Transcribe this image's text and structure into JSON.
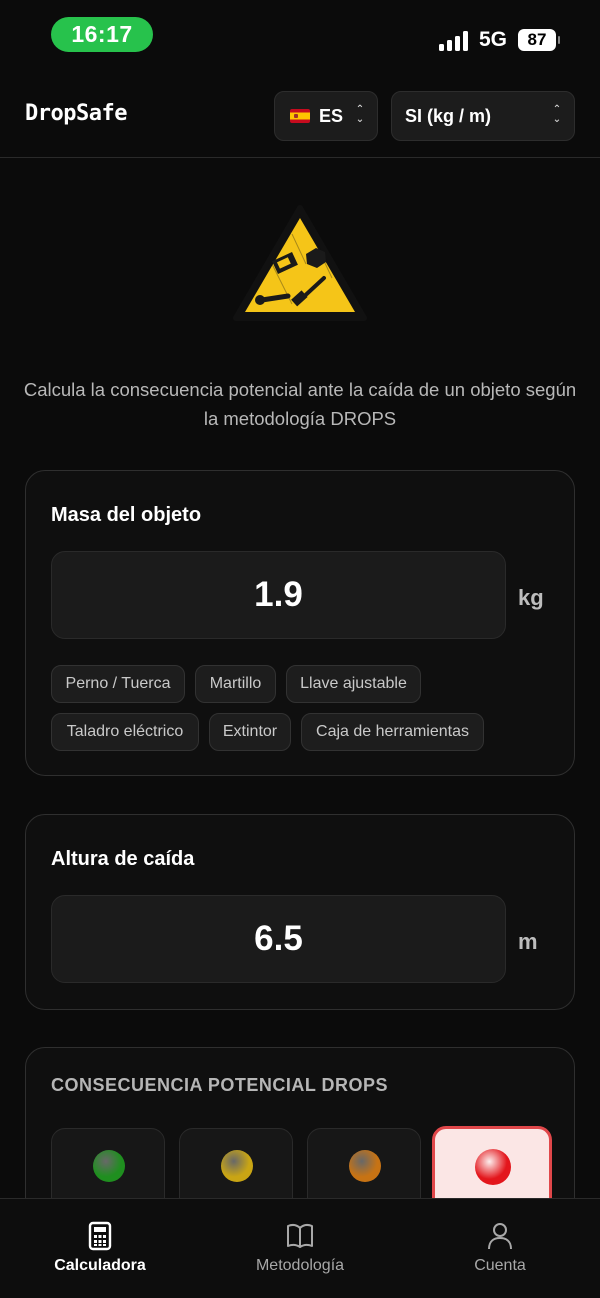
{
  "status_bar": {
    "time": "16:17",
    "network": "5G",
    "battery": "87"
  },
  "header": {
    "brand": "DropSafe",
    "language": {
      "flag": "spain-flag",
      "value": "ES"
    },
    "units": {
      "value": "SI (kg / m)"
    }
  },
  "hero": {
    "icon": "falling-objects-warning-icon",
    "description": "Calcula la consecuencia potencial ante la caída de un objeto según la metodología DROPS"
  },
  "mass_card": {
    "title": "Masa del objeto",
    "value": "1.9",
    "unit": "kg",
    "presets": [
      "Perno / Tuerca",
      "Martillo",
      "Llave ajustable",
      "Taladro eléctrico",
      "Extintor",
      "Caja de herramientas"
    ]
  },
  "height_card": {
    "title": "Altura de caída",
    "value": "6.5",
    "unit": "m"
  },
  "result_card": {
    "title": "CONSECUENCIA POTENCIAL DROPS",
    "selected_level": 3,
    "level_colors": [
      "#1f8f1f",
      "#c9a514",
      "#c77314",
      "#e3161c"
    ],
    "active_bg": "#fbe6e5"
  },
  "bottom_nav": {
    "items": [
      {
        "label": "Calculadora",
        "icon": "calculator-icon",
        "active": true
      },
      {
        "label": "Metodología",
        "icon": "book-icon",
        "active": false
      },
      {
        "label": "Cuenta",
        "icon": "user-icon",
        "active": false
      }
    ]
  }
}
